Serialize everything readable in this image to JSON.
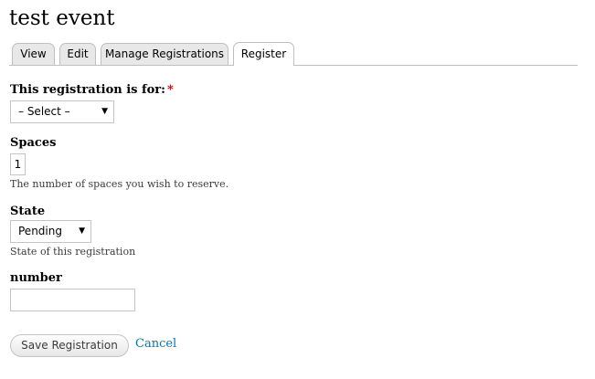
{
  "page": {
    "title": "test event"
  },
  "tabs": [
    {
      "label": "View",
      "active": false
    },
    {
      "label": "Edit",
      "active": false
    },
    {
      "label": "Manage Registrations",
      "active": false
    },
    {
      "label": "Register",
      "active": true
    }
  ],
  "form": {
    "registration_for": {
      "label": "This registration is for:",
      "required_marker": "*",
      "selected": "– Select –"
    },
    "spaces": {
      "label": "Spaces",
      "value": "1",
      "description": "The number of spaces you wish to reserve."
    },
    "state": {
      "label": "State",
      "selected": "Pending",
      "description": "State of this registration"
    },
    "number": {
      "label": "number",
      "value": ""
    },
    "actions": {
      "save_label": "Save Registration",
      "cancel_label": "Cancel"
    }
  },
  "colors": {
    "link": "#0074bd",
    "required": "#cc0000",
    "tab_inactive_bg": "#e8e8e8",
    "border": "#bfbfbf"
  }
}
